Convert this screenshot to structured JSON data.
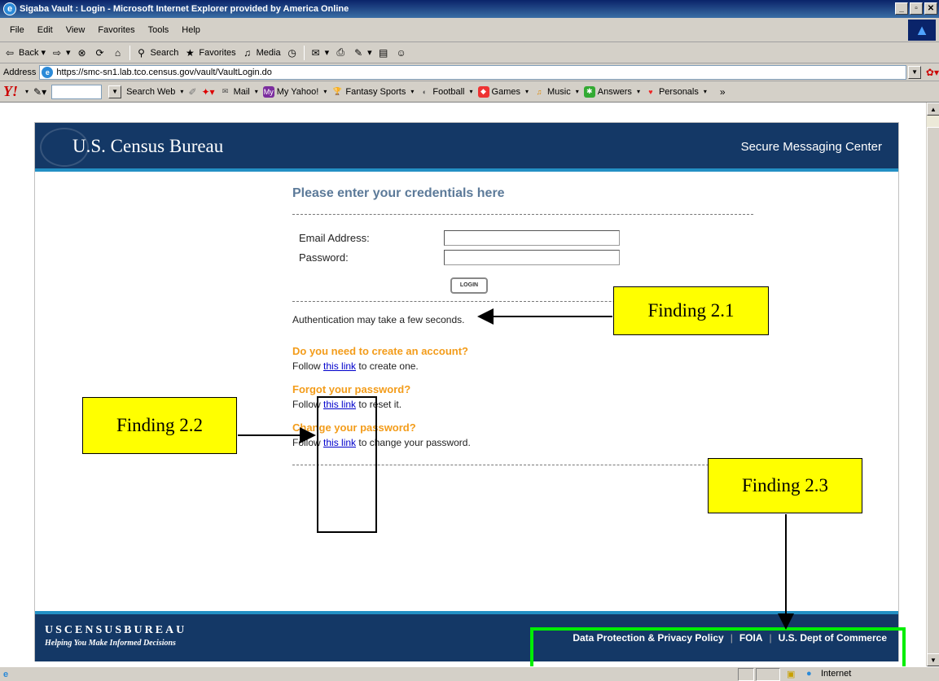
{
  "window": {
    "title": "Sigaba Vault : Login - Microsoft Internet Explorer provided by America Online"
  },
  "menu": [
    "File",
    "Edit",
    "View",
    "Favorites",
    "Tools",
    "Help"
  ],
  "toolbar": {
    "back": "Back",
    "search": "Search",
    "favorites": "Favorites",
    "media": "Media"
  },
  "address": {
    "label": "Address",
    "url": "https://smc-sn1.lab.tco.census.gov/vault/VaultLogin.do"
  },
  "yahoo": {
    "logo": "Y!",
    "search_button": "Search Web",
    "items": [
      "Mail",
      "My Yahoo!",
      "Fantasy Sports",
      "Football",
      "Games",
      "Music",
      "Answers",
      "Personals"
    ]
  },
  "header": {
    "brand": "U.S. Census Bureau",
    "right": "Secure Messaging Center"
  },
  "login": {
    "title": "Please enter your credentials here",
    "email_label": "Email Address:",
    "password_label": "Password:",
    "button": "LOGIN",
    "auth_note": "Authentication may take a few seconds."
  },
  "help": [
    {
      "q": "Do you need to create an account?",
      "pre": "Follow ",
      "link": "this link",
      "post": " to create one."
    },
    {
      "q": "Forgot your password?",
      "pre": "Follow ",
      "link": "this link",
      "post": " to reset it."
    },
    {
      "q": "Change your password?",
      "pre": "Follow ",
      "link": "this link",
      "post": " to change your password."
    }
  ],
  "footer": {
    "brand": "USCENSUSBUREAU",
    "tagline": "Helping You Make Informed Decisions",
    "links": [
      "Data Protection & Privacy Policy",
      "FOIA",
      "U.S. Dept of Commerce"
    ]
  },
  "annotations": {
    "f1": "Finding 2.1",
    "f2": "Finding 2.2",
    "f3": "Finding 2.3"
  },
  "status": {
    "zone": "Internet"
  }
}
